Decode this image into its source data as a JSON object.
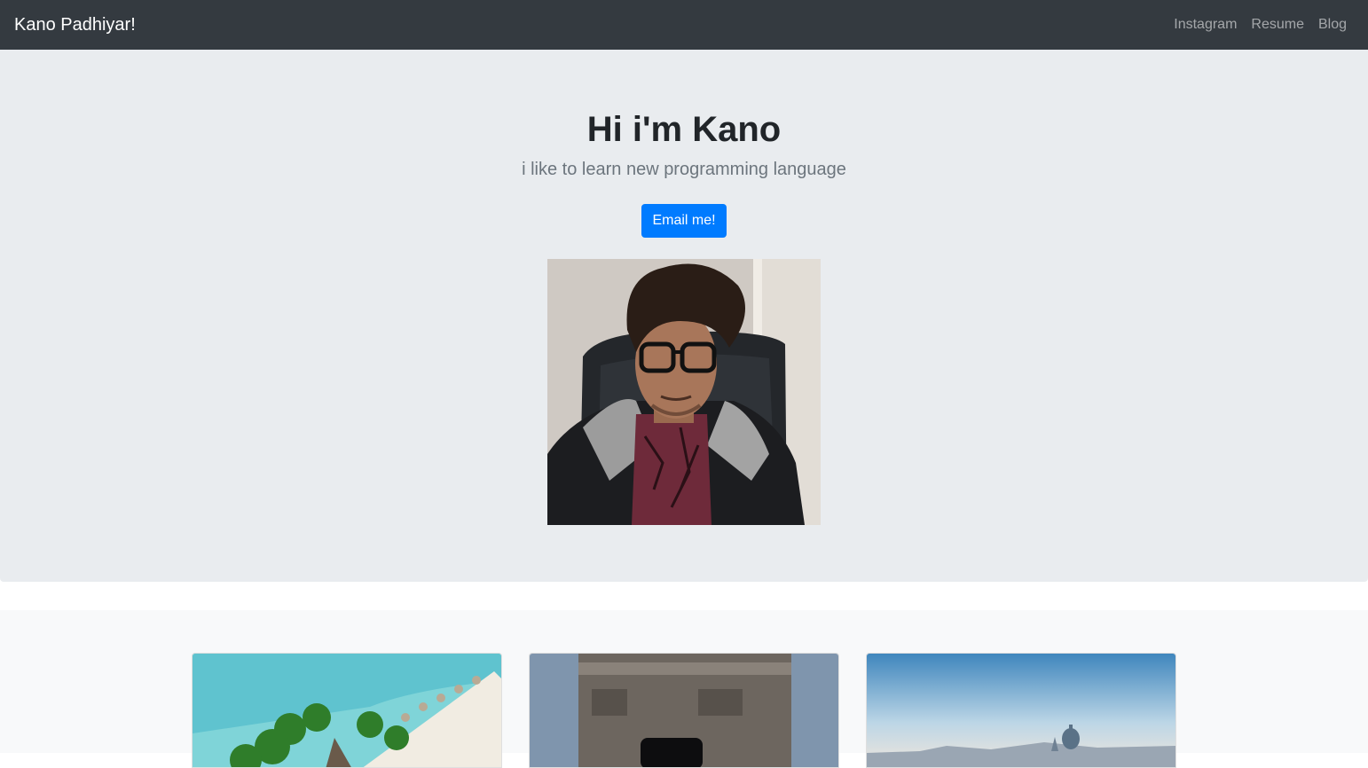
{
  "navbar": {
    "brand": "Kano Padhiyar!",
    "links": [
      "Instagram",
      "Resume",
      "Blog"
    ]
  },
  "hero": {
    "title": "Hi i'm Kano",
    "lead": "i like to learn new programming language",
    "button_label": "Email me!"
  },
  "colors": {
    "navbar_bg": "#343a40",
    "hero_bg": "#e9ecef",
    "button_bg": "#007bff",
    "album_bg": "#f8f9fa"
  },
  "cards": [
    {
      "image": "tropical-beach-photo"
    },
    {
      "image": "arc-de-triomphe-photo"
    },
    {
      "image": "city-skyline-photo"
    }
  ]
}
